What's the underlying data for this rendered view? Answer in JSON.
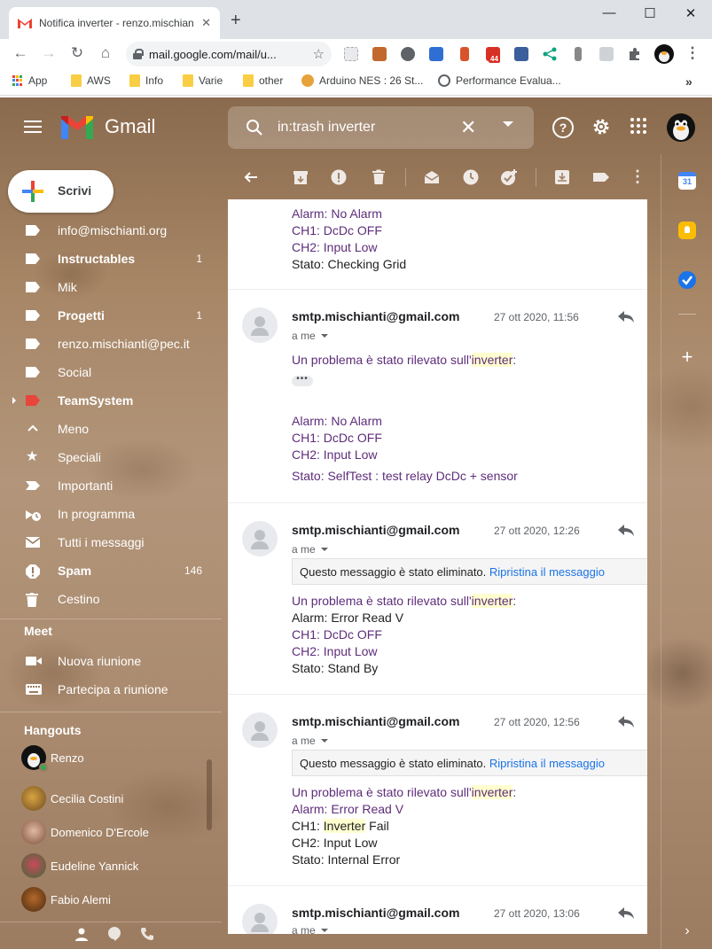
{
  "browser": {
    "tab_title": "Notifica inverter - renzo.mischian",
    "tab_close": "✕",
    "new_tab": "+",
    "window_controls": {
      "minimize": "—",
      "maximize": "☐",
      "close": "✕"
    },
    "url": "mail.google.com/mail/u...",
    "bookmarks": [
      "App",
      "AWS",
      "Info",
      "Varie",
      "other",
      "Arduino NES : 26 St...",
      "Performance Evalua..."
    ],
    "bookmarks_more": "»",
    "extension_badge": "44"
  },
  "gmail": {
    "logo_text": "Gmail",
    "search_value": "in:trash inverter",
    "compose_label": "Scrivi",
    "nav_items": [
      {
        "label": "info@mischianti.org",
        "count": "",
        "bold": false,
        "icon": "label-icon"
      },
      {
        "label": "Instructables",
        "count": "1",
        "bold": true,
        "icon": "label-icon"
      },
      {
        "label": "Mik",
        "count": "",
        "bold": false,
        "icon": "label-icon"
      },
      {
        "label": "Progetti",
        "count": "1",
        "bold": true,
        "icon": "label-icon"
      },
      {
        "label": "renzo.mischianti@pec.it",
        "count": "",
        "bold": false,
        "icon": "label-icon"
      },
      {
        "label": "Social",
        "count": "",
        "bold": false,
        "icon": "label-icon"
      },
      {
        "label": "TeamSystem",
        "count": "",
        "bold": true,
        "icon": "label-icon"
      },
      {
        "label": "Meno",
        "count": "",
        "bold": false,
        "icon": "chevron-up-icon"
      },
      {
        "label": "Speciali",
        "count": "",
        "bold": false,
        "icon": "star-icon"
      },
      {
        "label": "Importanti",
        "count": "",
        "bold": false,
        "icon": "important-icon"
      },
      {
        "label": "In programma",
        "count": "",
        "bold": false,
        "icon": "scheduled-icon"
      },
      {
        "label": "Tutti i messaggi",
        "count": "",
        "bold": false,
        "icon": "all-mail-icon"
      },
      {
        "label": "Spam",
        "count": "146",
        "bold": true,
        "icon": "spam-icon"
      },
      {
        "label": "Cestino",
        "count": "",
        "bold": false,
        "icon": "trash-icon"
      }
    ],
    "meet": {
      "title": "Meet",
      "new_meeting": "Nuova riunione",
      "join_meeting": "Partecipa a riunione"
    },
    "hangouts": {
      "title": "Hangouts",
      "contacts": [
        "Renzo",
        "Cecilia Costini",
        "Domenico D'Ercole",
        "Eudeline Yannick",
        "Fabio Alemi"
      ]
    },
    "colors": {
      "label_teamsystem": "#e8453c",
      "link": "#1a73e8",
      "highlight": "#ffffd0",
      "message_purple": "#5e2d7a"
    }
  },
  "messages": {
    "partial_top": {
      "lines": [
        "Alarm: No Alarm",
        "CH1: DcDc OFF",
        "CH2: Input Low",
        "Stato: Checking Grid"
      ]
    },
    "list": [
      {
        "sender": "smtp.mischianti@gmail.com",
        "date": "27 ott 2020, 11:56",
        "to": "a me",
        "intro_pre": "Un problema è stato rilevato sull'",
        "intro_hl": "inverter",
        "intro_post": ":",
        "ellipsis": "•••",
        "lines": [
          "Alarm: No Alarm",
          "CH1: DcDc OFF",
          "CH2: Input Low",
          "Stato: SelfTest : test relay DcDc + sensor"
        ]
      },
      {
        "sender": "smtp.mischianti@gmail.com",
        "date": "27 ott 2020, 12:26",
        "to": "a me",
        "deleted_text": "Questo messaggio è stato eliminato. ",
        "restore_link": "Ripristina il messaggio",
        "intro_pre": "Un problema è stato rilevato sull'",
        "intro_hl": "inverter",
        "intro_post": ":",
        "lines": [
          "Alarm: Error Read V",
          "CH1: DcDc OFF",
          "CH2: Input Low",
          "Stato: Stand By"
        ]
      },
      {
        "sender": "smtp.mischianti@gmail.com",
        "date": "27 ott 2020, 12:56",
        "to": "a me",
        "deleted_text": "Questo messaggio è stato eliminato. ",
        "restore_link": "Ripristina il messaggio",
        "intro_pre": "Un problema è stato rilevato sull'",
        "intro_hl": "inverter",
        "intro_post": ":",
        "lines": [
          "Alarm: Error Read V",
          "CH1: ",
          "CH2: Input Low",
          "Stato: Internal Error"
        ],
        "ch1_hl": "Inverter",
        "ch1_post": " Fail"
      },
      {
        "sender": "smtp.mischianti@gmail.com",
        "date": "27 ott 2020, 13:06",
        "to": "a me"
      }
    ]
  }
}
